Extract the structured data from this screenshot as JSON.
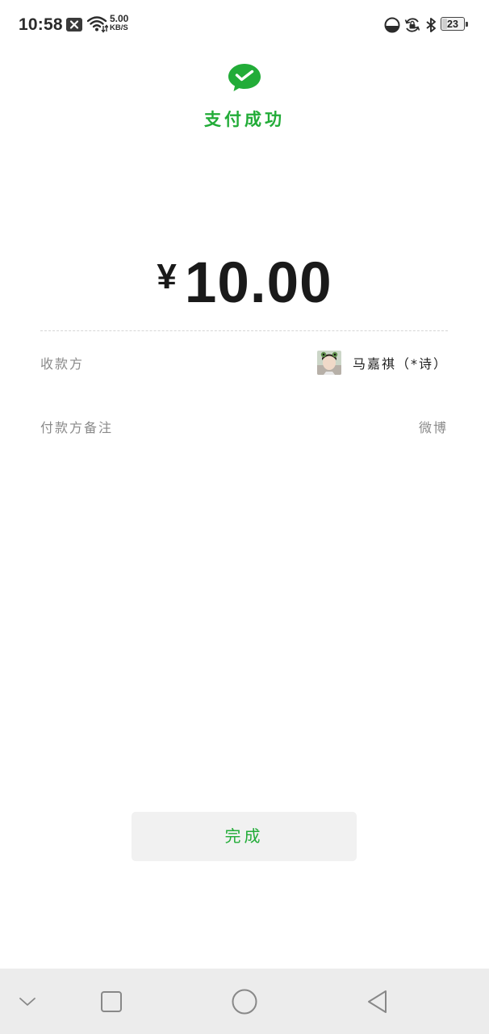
{
  "status_bar": {
    "time": "10:58",
    "net_speed_value": "5.00",
    "net_speed_unit": "KB/S",
    "battery_level": "23",
    "battery_fraction": 0.23
  },
  "icons": {
    "notification": "close-box-icon",
    "wifi": "wifi-icon",
    "dnd": "do-not-disturb-icon",
    "rotation_lock": "rotation-lock-icon",
    "bluetooth": "bluetooth-icon",
    "battery": "battery-icon",
    "wechat_pay": "wechat-pay-icon"
  },
  "colors": {
    "accent": "#22ac38",
    "label": "#8a8a8a",
    "button_bg": "#f1f1f1",
    "navbar_bg": "#ececec"
  },
  "header": {
    "title": "支付成功"
  },
  "amount": {
    "currency": "¥",
    "value": "10.00"
  },
  "details": {
    "payee_label": "收款方",
    "payee_name": "马嘉祺（*诗）",
    "remark_label": "付款方备注",
    "remark_value": "微博"
  },
  "actions": {
    "done_label": "完成"
  }
}
